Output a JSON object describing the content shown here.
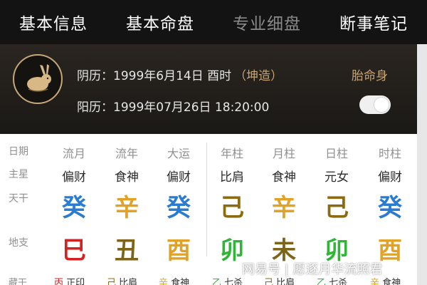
{
  "nav": {
    "tabs": [
      {
        "label": "基本信息"
      },
      {
        "label": "基本命盘"
      },
      {
        "label": "专业细盘"
      },
      {
        "label": "断事笔记"
      }
    ]
  },
  "profile": {
    "lunar_label": "阴历：",
    "lunar_date": "1999年6月14日 酉时",
    "gender_tag": "（坤造）",
    "solar_label": "阳历：",
    "solar_date": "1999年07月26日 18:20:00",
    "body_link": "胎命身"
  },
  "table": {
    "row_labels": [
      "日期",
      "主星",
      "天干",
      "地支",
      "藏干"
    ],
    "columns": [
      {
        "head": "流月",
        "star": "偏财",
        "stem": "癸",
        "branch": "巳"
      },
      {
        "head": "流年",
        "star": "食神",
        "stem": "辛",
        "branch": "丑"
      },
      {
        "head": "大运",
        "star": "偏财",
        "stem": "癸",
        "branch": "酉"
      },
      {
        "head": "年柱",
        "star": "比肩",
        "stem": "己",
        "branch": "卯"
      },
      {
        "head": "月柱",
        "star": "食神",
        "stem": "辛",
        "branch": "未"
      },
      {
        "head": "日柱",
        "star": "元女",
        "stem": "己",
        "branch": "卯"
      },
      {
        "head": "时柱",
        "star": "偏财",
        "stem": "癸",
        "branch": "酉"
      }
    ],
    "hidden_stems": [
      "丙 正印",
      "己 比肩",
      "辛 食神",
      "乙 七杀",
      "己 比肩",
      "乙 七杀",
      "辛 食神"
    ]
  },
  "colors": {
    "癸": "#2a7bd2",
    "辛": "#e0a227",
    "己": "#8b6b12",
    "巳": "#d32222",
    "丑": "#7c6418",
    "酉": "#e0a227",
    "卯": "#31b539",
    "未": "#7c6418",
    "丙": "#d32222",
    "乙": "#31b539"
  },
  "watermark": "网易号 | 愿逐月华流照君"
}
